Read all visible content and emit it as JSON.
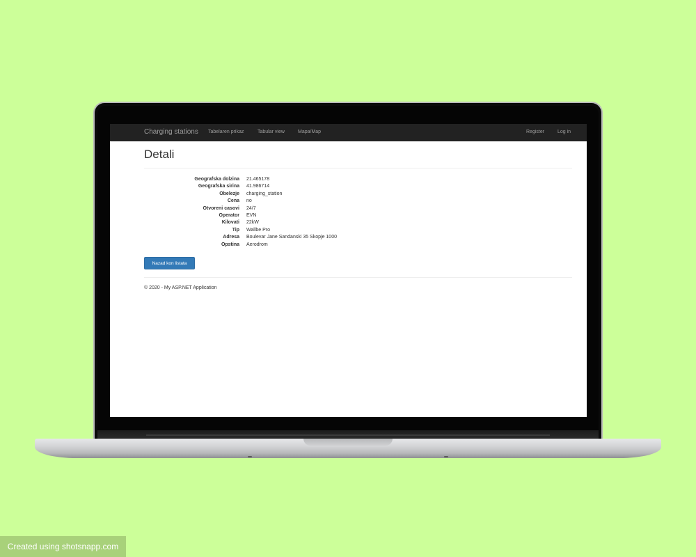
{
  "navbar": {
    "brand": "Charging stations",
    "links": [
      "Tabelaren prikaz",
      "Tabular view",
      "Mapa/Map"
    ],
    "right_links": [
      "Register",
      "Log in"
    ]
  },
  "page": {
    "title": "Detali",
    "details": [
      {
        "label": "Geografska dolzina",
        "value": "21.465178"
      },
      {
        "label": "Geografska sirina",
        "value": "41.986714"
      },
      {
        "label": "Obelezje",
        "value": "charging_station"
      },
      {
        "label": "Cena",
        "value": "no"
      },
      {
        "label": "Otvoreni casovi",
        "value": "24/7"
      },
      {
        "label": "Operator",
        "value": "EVN"
      },
      {
        "label": "Kilovati",
        "value": "22kW"
      },
      {
        "label": "Tip",
        "value": "Wallbe Pro"
      },
      {
        "label": "Adresa",
        "value": "Boulevar Jane Sandanski 35 Skopje 1000"
      },
      {
        "label": "Opstina",
        "value": "Aerodrom"
      }
    ],
    "back_button": "Nazad kon listata",
    "footer": "© 2020 - My ASP.NET Application"
  },
  "watermark": "Created using shotsnapp.com",
  "colors": {
    "background": "#ccff99",
    "navbar": "#222222",
    "primary_button": "#337ab7"
  }
}
